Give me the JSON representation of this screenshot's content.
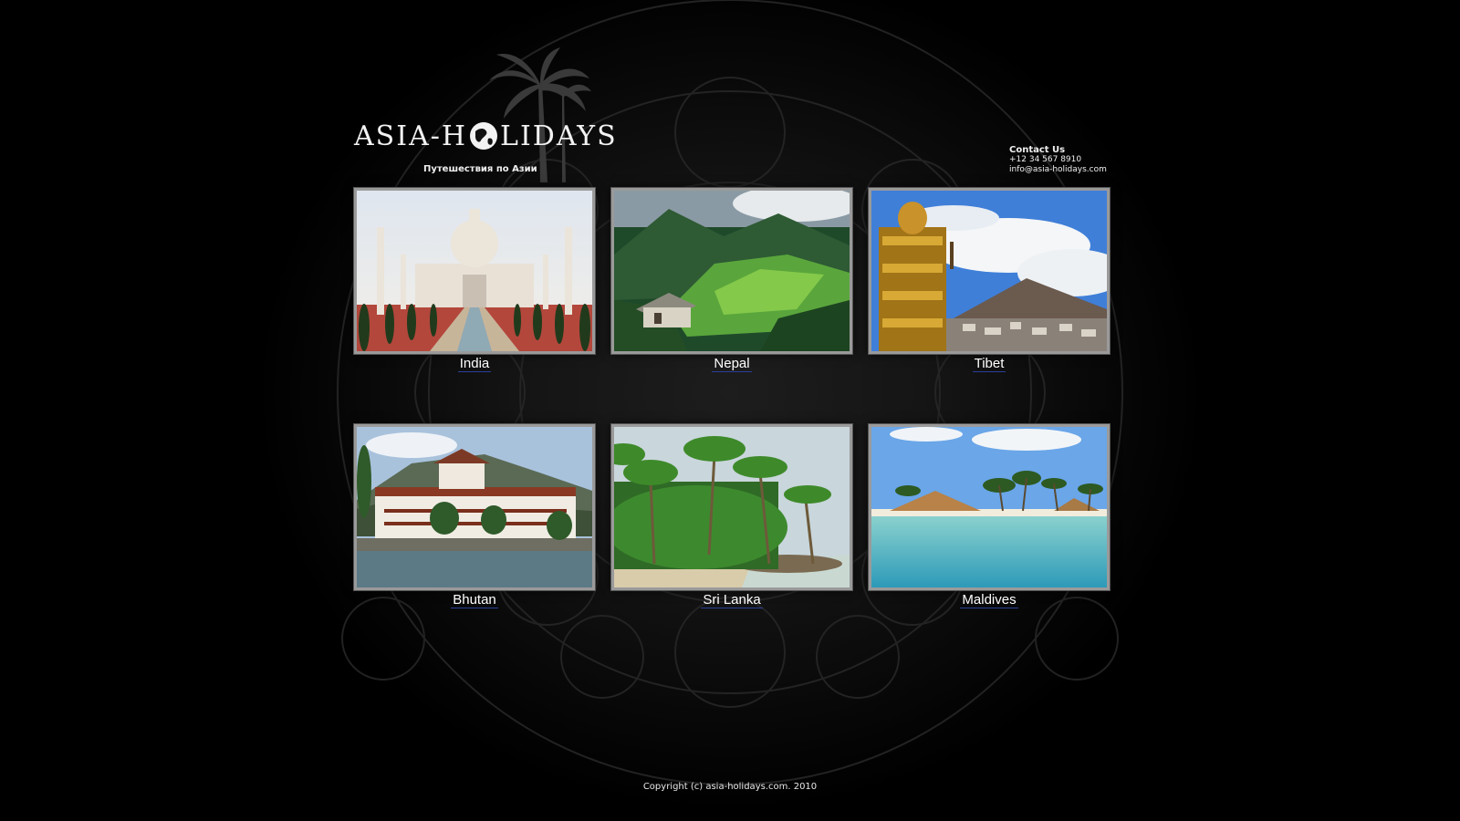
{
  "header": {
    "logo_text_left": "ASIA-H",
    "logo_text_right": "LIDAYS",
    "tagline": "Путешествия по Азии"
  },
  "contact": {
    "title": "Contact Us",
    "phone": "+12 34 567 8910",
    "email": "info@asia-holidays.com"
  },
  "destinations": [
    {
      "label": "India"
    },
    {
      "label": "Nepal"
    },
    {
      "label": "Tibet"
    },
    {
      "label": "Bhutan"
    },
    {
      "label": "Sri Lanka"
    },
    {
      "label": "Maldives"
    }
  ],
  "footer": {
    "copyright": "Copyright (c) asia-holidays.com. 2010"
  },
  "colors": {
    "background": "#000000",
    "frame_border": "#9a9a9a",
    "caption_underline": "#2a3f9a"
  }
}
